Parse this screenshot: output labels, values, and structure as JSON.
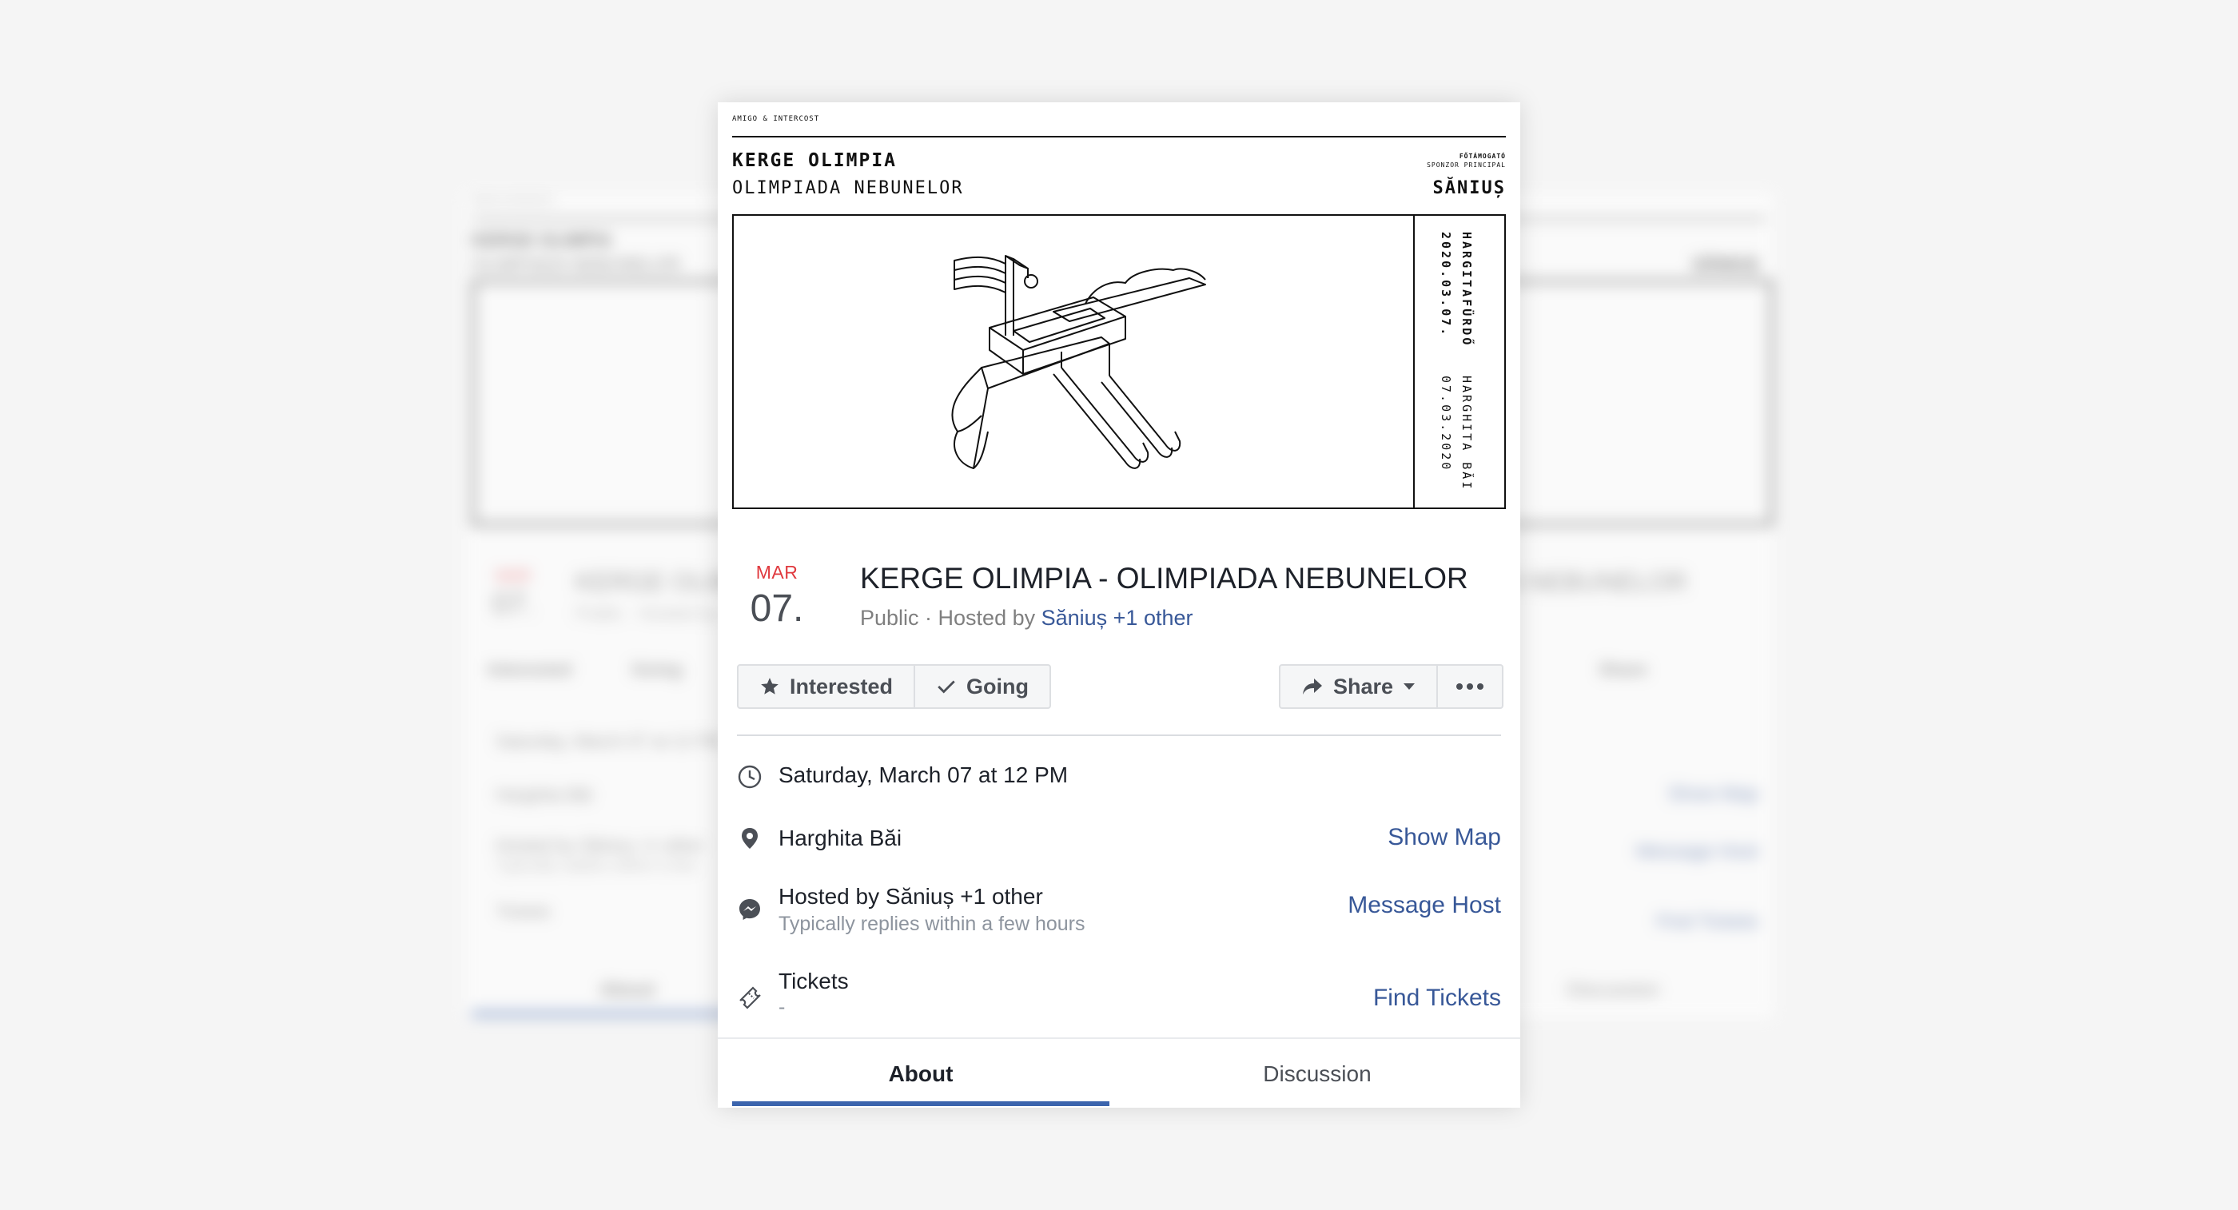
{
  "poster": {
    "org": "AMIGO & INTERCOST",
    "title": "KERGE OLIMPIA",
    "subtitle": "OLIMPIADA NEBUNELOR",
    "sponsor_line1": "FŐTÁMOGATÓ",
    "sponsor_line2": "SPONZOR PRINCIPAL",
    "sponsor_name": "SĂNIUȘ",
    "vertical_1": "HARGITAFÜRDŐ",
    "vertical_2": "2020.03.07.",
    "vertical_3": "HARGHITA BĂI",
    "vertical_4": "07.03.2020"
  },
  "event": {
    "month": "MAR",
    "day": "07.",
    "title": "KERGE OLIMPIA - OLIMPIADA NEBUNELOR",
    "privacy": "Public · Hosted by ",
    "host_link": "Săniuș +1 other"
  },
  "actions": {
    "interested": "Interested",
    "going": "Going",
    "share": "Share"
  },
  "details": {
    "datetime": "Saturday, March 07 at 12 PM",
    "location": "Harghita Băi",
    "show_map": "Show Map",
    "hosted_by": "Hosted by Săniuș +1 other",
    "reply_time": "Typically replies within a few hours",
    "message_host": "Message Host",
    "tickets": "Tickets",
    "tickets_value": "-",
    "find_tickets": "Find Tickets"
  },
  "tabs": {
    "about": "About",
    "discussion": "Discussion"
  },
  "ghost_left": {
    "org": "AMIGO & INTERCOST",
    "title": "KERGE OLIMPIA",
    "subtitle": "OLIMPIADA NEBUNELOR",
    "month": "MAR",
    "day": "07.",
    "event_title": "KERGE OLIMP",
    "meta": "Public · Hosted by",
    "interested": "Interested",
    "going": "Going",
    "datetime": "Saturday, March 07 at 12 PM",
    "location": "Harghita Băi",
    "hosted_by": "Hosted by Săniuș +1 other",
    "reply_time": "Typically replies within a few",
    "tickets": "Tickets",
    "about": "About"
  },
  "ghost_right": {
    "sponsor_name": "SĂNIUȘ",
    "event_title": "DA NEBUNELOR",
    "share": "Share",
    "show_map": "Show Map",
    "message_host": "Message Host",
    "find_tickets": "Find Tickets",
    "discussion": "Discussion"
  },
  "colors": {
    "accent": "#385898",
    "tab_underline": "#3b64ad",
    "month": "#e0393e"
  }
}
